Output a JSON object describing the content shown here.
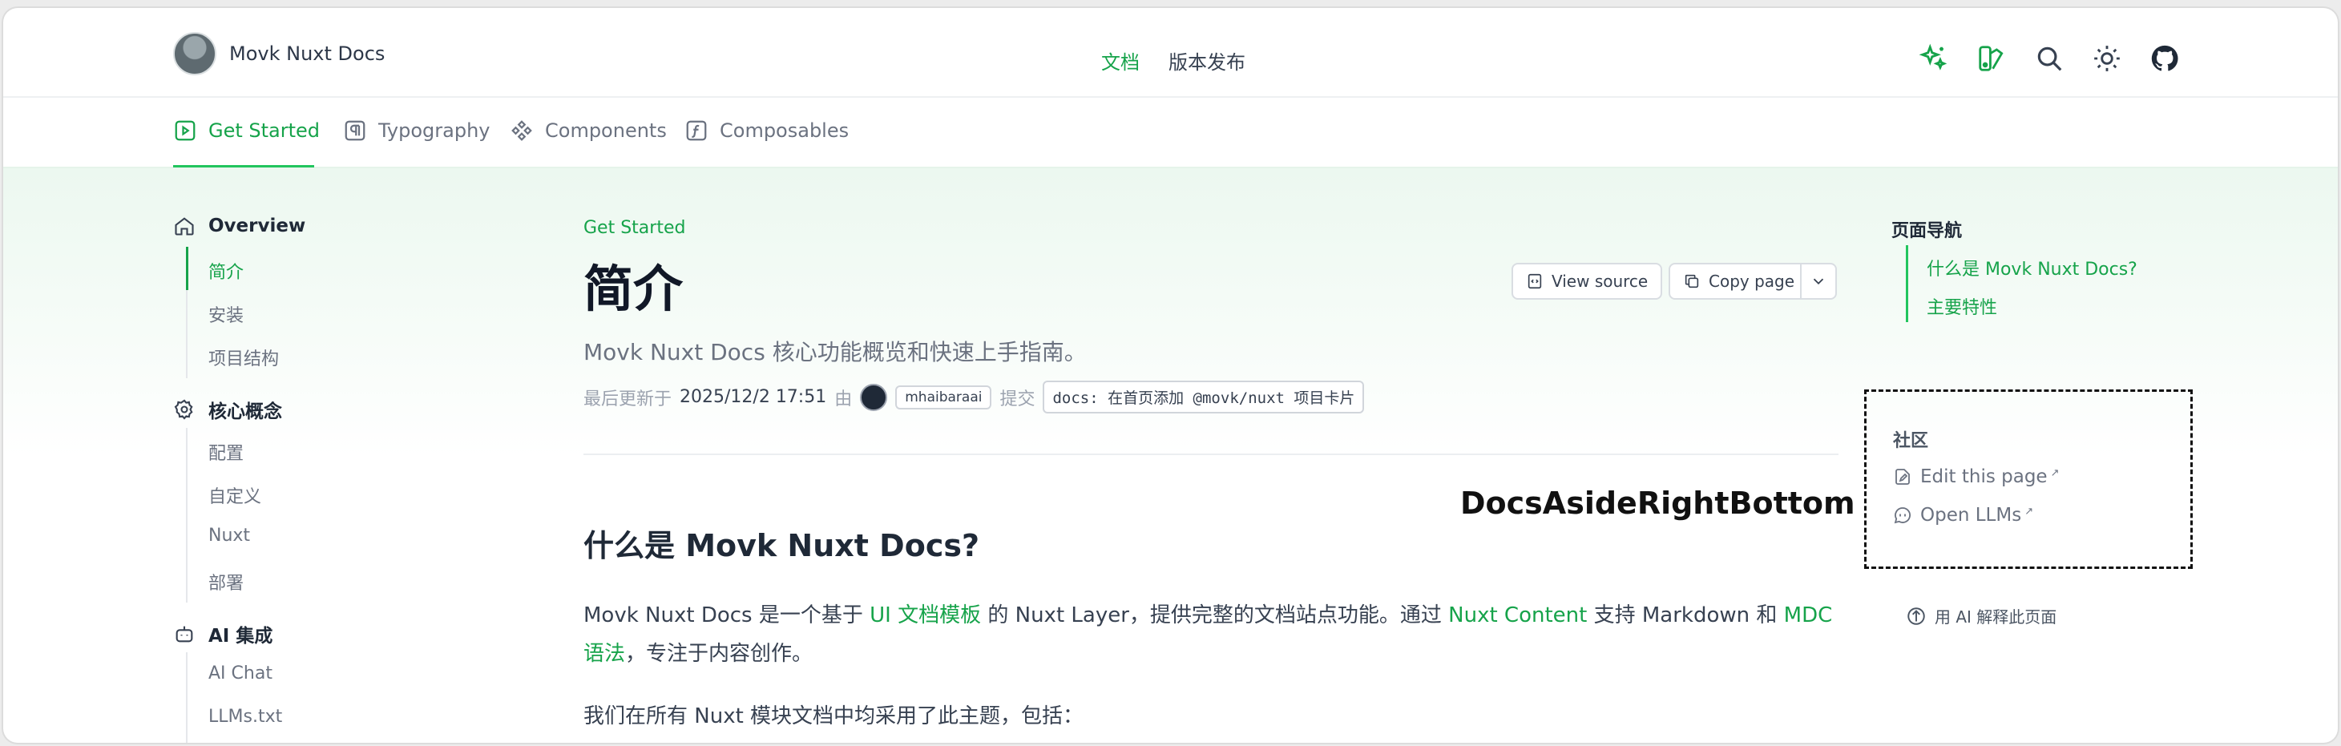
{
  "header": {
    "brand": "Movk Nuxt Docs",
    "nav": [
      {
        "label": "文档"
      },
      {
        "label": "版本发布"
      }
    ]
  },
  "tabs": [
    {
      "label": "Get Started"
    },
    {
      "label": "Typography"
    },
    {
      "label": "Components"
    },
    {
      "label": "Composables"
    }
  ],
  "sidebar": {
    "groups": [
      {
        "label": "Overview",
        "items": [
          "简介",
          "安装",
          "项目结构"
        ]
      },
      {
        "label": "核心概念",
        "items": [
          "配置",
          "自定义",
          "Nuxt",
          "部署"
        ]
      },
      {
        "label": "AI 集成",
        "items": [
          "AI Chat",
          "LLMs.txt"
        ]
      }
    ],
    "active_item": "简介"
  },
  "page": {
    "eyebrow": "Get Started",
    "title": "简介",
    "view_source": "View source",
    "copy_page": "Copy page",
    "subtitle": "Movk Nuxt Docs 核心功能概览和快速上手指南。",
    "meta": {
      "updated_label": "最后更新于",
      "date": "2025/12/2 17:51",
      "by": "由",
      "author": "mhaibaraai",
      "commit_label": "提交",
      "commit_message": "docs: 在首页添加 @movk/nuxt 项目卡片"
    },
    "section_title": "什么是 Movk Nuxt Docs?",
    "para1": {
      "t1": "Movk Nuxt Docs 是一个基于 ",
      "l1": "UI 文档模板",
      "t2": " 的 Nuxt Layer，提供完整的文档站点功能。通过 ",
      "l2": "Nuxt Content",
      "t3": " 支持 Markdown 和 ",
      "l3": "MDC",
      "l4": "语法",
      "t4": "，专注于内容创作。"
    },
    "para2": "我们在所有 Nuxt 模块文档中均采用了此主题，包括："
  },
  "aside": {
    "toc_title": "页面导航",
    "toc": [
      "什么是 Movk Nuxt Docs?",
      "主要特性"
    ],
    "community_title": "社区",
    "community": [
      {
        "label": "Edit this page",
        "icon": "file-edit-icon"
      },
      {
        "label": "Open LLMs",
        "icon": "chat-icon"
      }
    ],
    "annotation": "DocsAsideRightBottom",
    "ai_explain": "用 AI 解释此页面"
  },
  "colors": {
    "accent": "#16a34a",
    "text": "#1f2937",
    "muted": "#6b7280"
  }
}
